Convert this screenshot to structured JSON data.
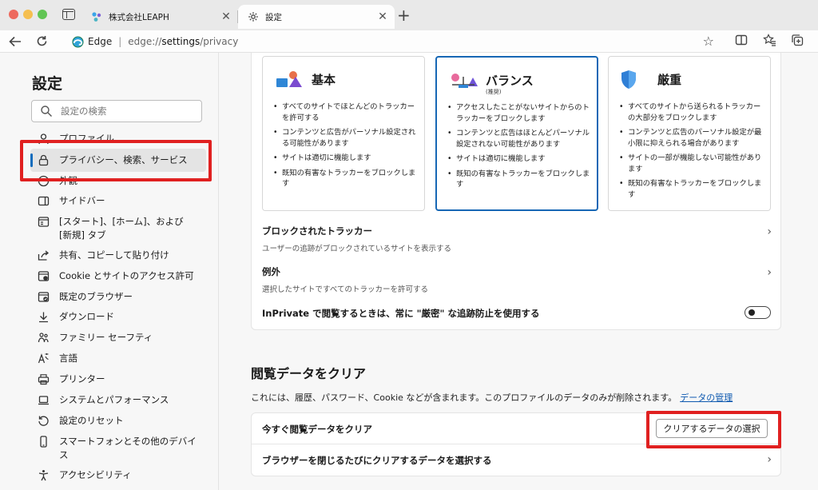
{
  "tabs": [
    {
      "title": "株式会社LEAPH",
      "close": "✕"
    },
    {
      "title": "設定",
      "close": "✕"
    }
  ],
  "newtab_symbol": "+",
  "address": {
    "brand": "Edge",
    "separator": "|",
    "scheme": "edge://",
    "host": "settings",
    "path": "/privacy"
  },
  "sidebar": {
    "title": "設定",
    "search_placeholder": "設定の検索",
    "items": [
      {
        "label": "プロファイル",
        "icon": "profile-icon"
      },
      {
        "label": "プライバシー、検索、サービス",
        "icon": "lock-icon"
      },
      {
        "label": "外観",
        "icon": "appearance-icon"
      },
      {
        "label": "サイドバー",
        "icon": "sidebar-icon"
      },
      {
        "label": "[スタート]、[ホーム]、および",
        "label2": "[新規] タブ",
        "icon": "home-icon"
      },
      {
        "label": "共有、コピーして貼り付け",
        "icon": "share-icon"
      },
      {
        "label": "Cookie とサイトのアクセス許可",
        "icon": "cookie-icon"
      },
      {
        "label": "既定のブラウザー",
        "icon": "browser-icon"
      },
      {
        "label": "ダウンロード",
        "icon": "download-icon"
      },
      {
        "label": "ファミリー セーフティ",
        "icon": "family-icon"
      },
      {
        "label": "言語",
        "icon": "language-icon"
      },
      {
        "label": "プリンター",
        "icon": "printer-icon"
      },
      {
        "label": "システムとパフォーマンス",
        "icon": "laptop-icon"
      },
      {
        "label": "設定のリセット",
        "icon": "reset-icon"
      },
      {
        "label": "スマートフォンとその他のデバイ",
        "label2": "ス",
        "icon": "phone-icon"
      },
      {
        "label": "アクセシビリティ",
        "icon": "accessibility-icon"
      }
    ]
  },
  "tracking": {
    "cards": [
      {
        "title": "基本",
        "sub": "",
        "icon": "shapes-icon",
        "bullets": [
          "すべてのサイトでほとんどのトラッカーを許可する",
          "コンテンツと広告がパーソナル設定される可能性があります",
          "サイトは適切に機能します",
          "既知の有害なトラッカーをブロックします"
        ]
      },
      {
        "title": "バランス",
        "sub": "(推奨)",
        "icon": "balance-icon",
        "bullets": [
          "アクセスしたことがないサイトからのトラッカーをブロックします",
          "コンテンツと広告はほとんどパーソナル設定されない可能性があります",
          "サイトは適切に機能します",
          "既知の有害なトラッカーをブロックします"
        ]
      },
      {
        "title": "厳重",
        "sub": "",
        "icon": "shield-icon",
        "bullets": [
          "すべてのサイトから送られるトラッカーの大部分をブロックします",
          "コンテンツと広告のパーソナル設定が最小限に抑えられる場合があります",
          "サイトの一部が機能しない可能性があります",
          "既知の有害なトラッカーをブロックします"
        ]
      }
    ],
    "blocked": {
      "title": "ブロックされたトラッカー",
      "desc": "ユーザーの追跡がブロックされているサイトを表示する"
    },
    "exceptions": {
      "title": "例外",
      "desc": "選択したサイトですべてのトラッカーを許可する"
    },
    "inprivate": {
      "label": "InPrivate で閲覧するときは、常に \"厳密\" な追跡防止を使用する",
      "enabled": false
    }
  },
  "clear_data": {
    "title": "閲覧データをクリア",
    "desc": "これには、履歴、パスワード、Cookie などが含まれます。このプロファイルのデータのみが削除されます。",
    "manage_link": "データの管理",
    "now_label": "今すぐ閲覧データをクリア",
    "choose_button": "クリアするデータの選択",
    "on_close_label": "ブラウザーを閉じるたびにクリアするデータを選択する"
  },
  "colors": {
    "accent": "#0f6cbd",
    "highlight": "#e02020"
  }
}
